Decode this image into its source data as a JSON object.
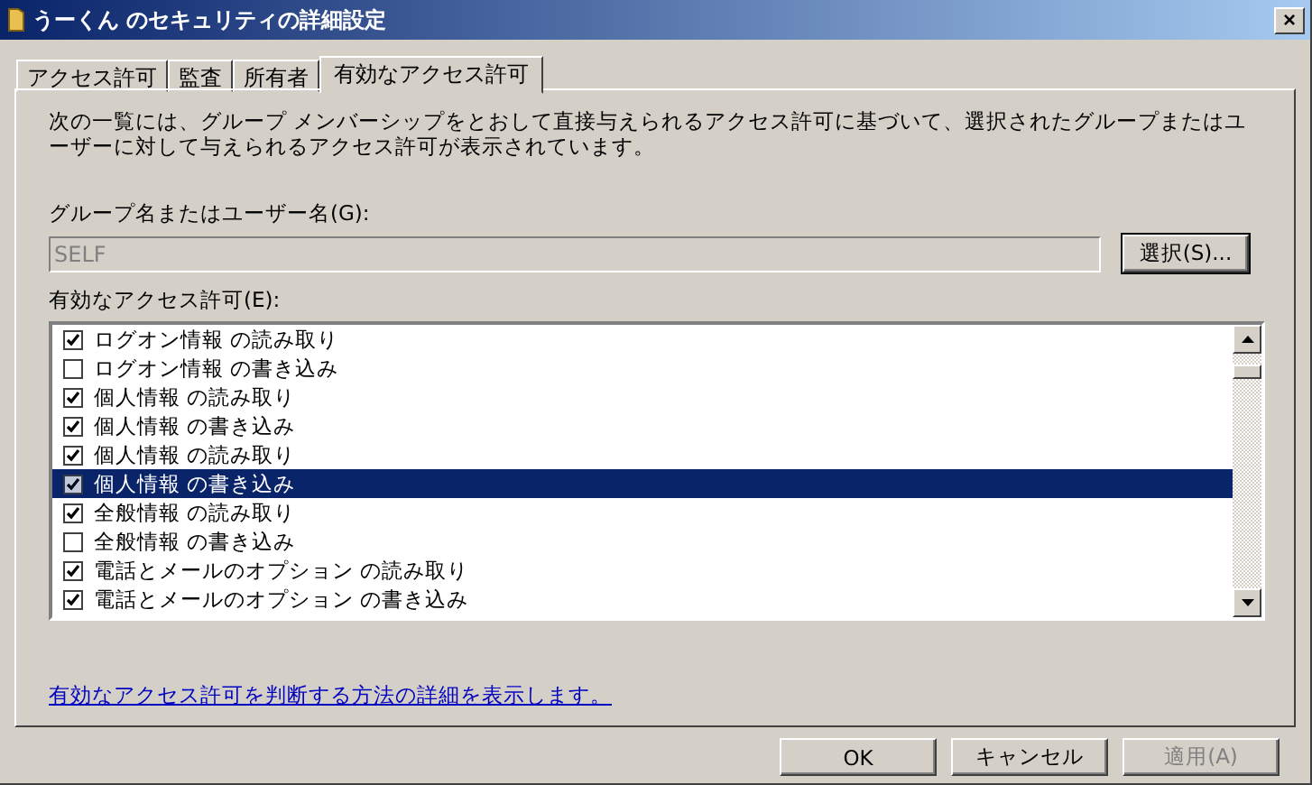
{
  "window": {
    "title": "うーくん のセキュリティの詳細設定",
    "close": "×"
  },
  "tabs": [
    {
      "label": "アクセス許可",
      "selected": false
    },
    {
      "label": "監査",
      "selected": false
    },
    {
      "label": "所有者",
      "selected": false
    },
    {
      "label": "有効なアクセス許可",
      "selected": true
    }
  ],
  "description": "次の一覧には、グループ メンバーシップをとおして直接与えられるアクセス許可に基づいて、選択されたグループまたはユーザーに対して与えられるアクセス許可が表示されています。",
  "group_label": "グループ名またはユーザー名(G):",
  "group_field": {
    "value": "SELF",
    "disabled": true
  },
  "select_button": "選択(S)...",
  "permissions_label": "有効なアクセス許可(E):",
  "permissions": [
    {
      "label": "ログオン情報 の読み取り",
      "checked": true,
      "selected": false
    },
    {
      "label": "ログオン情報 の書き込み",
      "checked": false,
      "selected": false
    },
    {
      "label": "個人情報 の読み取り",
      "checked": true,
      "selected": false
    },
    {
      "label": "個人情報 の書き込み",
      "checked": true,
      "selected": false
    },
    {
      "label": "個人情報 の読み取り",
      "checked": true,
      "selected": false
    },
    {
      "label": "個人情報 の書き込み",
      "checked": true,
      "selected": true
    },
    {
      "label": "全般情報 の読み取り",
      "checked": true,
      "selected": false
    },
    {
      "label": "全般情報 の書き込み",
      "checked": false,
      "selected": false
    },
    {
      "label": "電話とメールのオプション の読み取り",
      "checked": true,
      "selected": false
    },
    {
      "label": "電話とメールのオプション の書き込み",
      "checked": true,
      "selected": false
    }
  ],
  "help_link": "有効なアクセス許可を判断する方法の詳細を表示します。",
  "buttons": [
    {
      "label": "OK",
      "disabled": false
    },
    {
      "label": "キャンセル",
      "disabled": false
    },
    {
      "label": "適用(A)",
      "disabled": true
    }
  ]
}
